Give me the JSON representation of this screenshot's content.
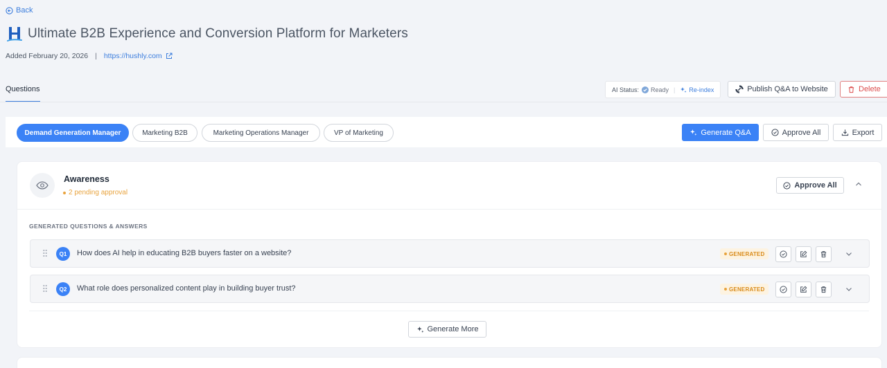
{
  "nav": {
    "back_label": "Back"
  },
  "page": {
    "title": "Ultimate B2B Experience and Conversion Platform for Marketers",
    "added": "Added February 20, 2026",
    "separator": "|",
    "url": "https://hushly.com"
  },
  "tabs": [
    {
      "label": "Questions",
      "active": true
    }
  ],
  "ai_status": {
    "label": "AI Status:",
    "status": "Ready",
    "divider": "|",
    "reindex_label": "Re-index"
  },
  "actions": {
    "publish_label": "Publish Q&A to Website",
    "delete_label": "Delete"
  },
  "personas": [
    {
      "label": "Demand Generation Manager",
      "active": true
    },
    {
      "label": "Marketing B2B",
      "active": false
    },
    {
      "label": "Marketing Operations Manager",
      "active": false
    },
    {
      "label": "VP of Marketing",
      "active": false
    }
  ],
  "toolbar": {
    "generate_label": "Generate Q&A",
    "approve_all_label": "Approve All",
    "export_label": "Export"
  },
  "stage": {
    "title": "Awareness",
    "pending": "2 pending approval",
    "approve_all_label": "Approve All",
    "section_label": "GENERATED QUESTIONS & ANSWERS",
    "questions": [
      {
        "badge": "Q1",
        "text": "How does AI help in educating B2B buyers faster on a website?",
        "status": "GENERATED"
      },
      {
        "badge": "Q2",
        "text": "What role does personalized content play in building buyer trust?",
        "status": "GENERATED"
      }
    ],
    "generate_more_label": "Generate More"
  },
  "colors": {
    "accent": "#3b82f6",
    "pending": "#e8a33d",
    "danger": "#dc4c4c",
    "ready": "#7fa7d9"
  }
}
